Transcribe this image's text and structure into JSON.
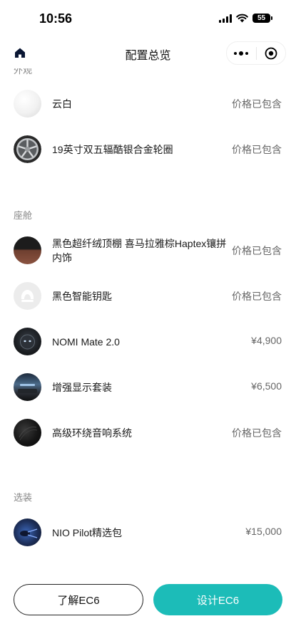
{
  "status": {
    "time": "10:56",
    "battery": "55"
  },
  "nav": {
    "title": "配置总览"
  },
  "sections": {
    "cut_label": "外观",
    "cockpit_label": "座舱",
    "options_label": "选装"
  },
  "items": [
    {
      "name": "云白",
      "price": "价格已包含",
      "icon": "white-paint-swatch"
    },
    {
      "name": "19英寸双五辐酷银合金轮圈",
      "price": "价格已包含",
      "icon": "alloy-wheel"
    },
    {
      "name": "黑色超纤绒顶棚 喜马拉雅棕Haptex镶拼内饰",
      "price": "价格已包含",
      "icon": "interior-swatch"
    },
    {
      "name": "黑色智能钥匙",
      "price": "价格已包含",
      "icon": "smart-key"
    },
    {
      "name": "NOMI Mate 2.0",
      "price": "¥4,900",
      "icon": "nomi-mate"
    },
    {
      "name": "增强显示套装",
      "price": "¥6,500",
      "icon": "display-kit"
    },
    {
      "name": "高级环绕音响系统",
      "price": "价格已包含",
      "icon": "speaker"
    },
    {
      "name": "NIO Pilot精选包",
      "price": "¥15,000",
      "icon": "nio-pilot"
    }
  ],
  "buttons": {
    "learn": "了解EC6",
    "design": "设计EC6"
  },
  "colors": {
    "accent": "#1cbcb8",
    "secondary_text": "#888888"
  }
}
